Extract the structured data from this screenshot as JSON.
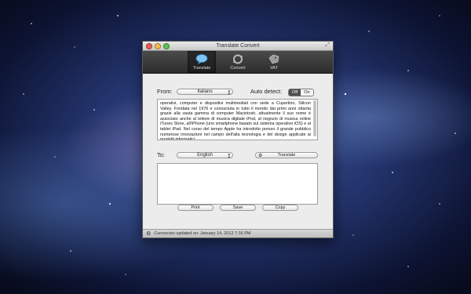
{
  "window": {
    "title": "Translate Convert"
  },
  "toolbar": {
    "items": [
      {
        "label": "Translate",
        "icon": "speech-bubble-icon"
      },
      {
        "label": "Convert",
        "icon": "convert-arrows-icon"
      },
      {
        "label": "VAT",
        "icon": "vat-tag-icon"
      }
    ]
  },
  "from": {
    "label": "From:",
    "language": "Italiano"
  },
  "auto_detect": {
    "label": "Auto detect:",
    "off": "Off",
    "on": "On"
  },
  "source_text": "operativi, computer e dispositivi multimediali con sede a Cupertino, Silicon Valley. Fondata nel 1976 e conosciuta in tutto il mondo dai primi anni ottanta grazie alla vasta gamma di computer Macintosh, attualmente il suo nome è associato anche al lettore di musica digitale iPod, al negozio di musica online iTunes Store, all'iPhone (uno smartphone basato sul sistema operativo iOS) e al tablet iPad. Nel corso del tempo Apple ha introdotto presso il grande pubblico numerose innovazioni nel campo dell'alta tecnologia e del design applicate ai prodotti informatici.",
  "to": {
    "label": "To:",
    "language": "English"
  },
  "translate_button": "Translate",
  "output_text": "",
  "buttons": {
    "print": "Print",
    "save": "Save",
    "copy": "Copy"
  },
  "status": {
    "text": "Currencies updated on: January 14, 2012 7:16 PM"
  },
  "colors": {
    "toolbar": "#333333",
    "toggle_active": "#4d4d4d"
  }
}
